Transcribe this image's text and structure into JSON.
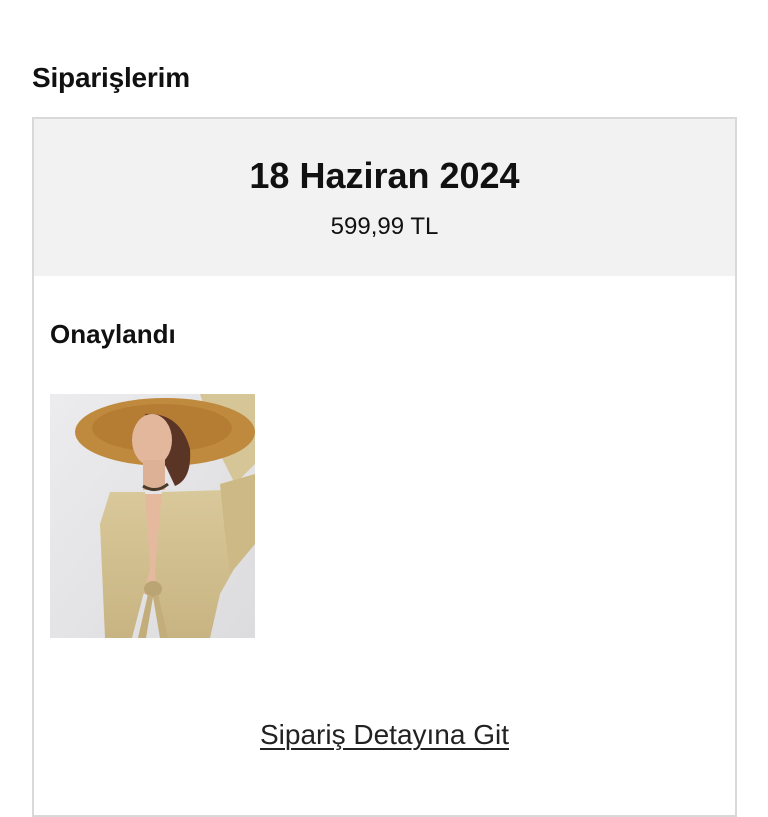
{
  "page": {
    "title": "Siparişlerim"
  },
  "order": {
    "date": "18 Haziran 2024",
    "total": "599,99 TL",
    "status": "Onaylandı",
    "product_image": "product-photo",
    "detail_link_label": "Sipariş Detayına Git"
  }
}
